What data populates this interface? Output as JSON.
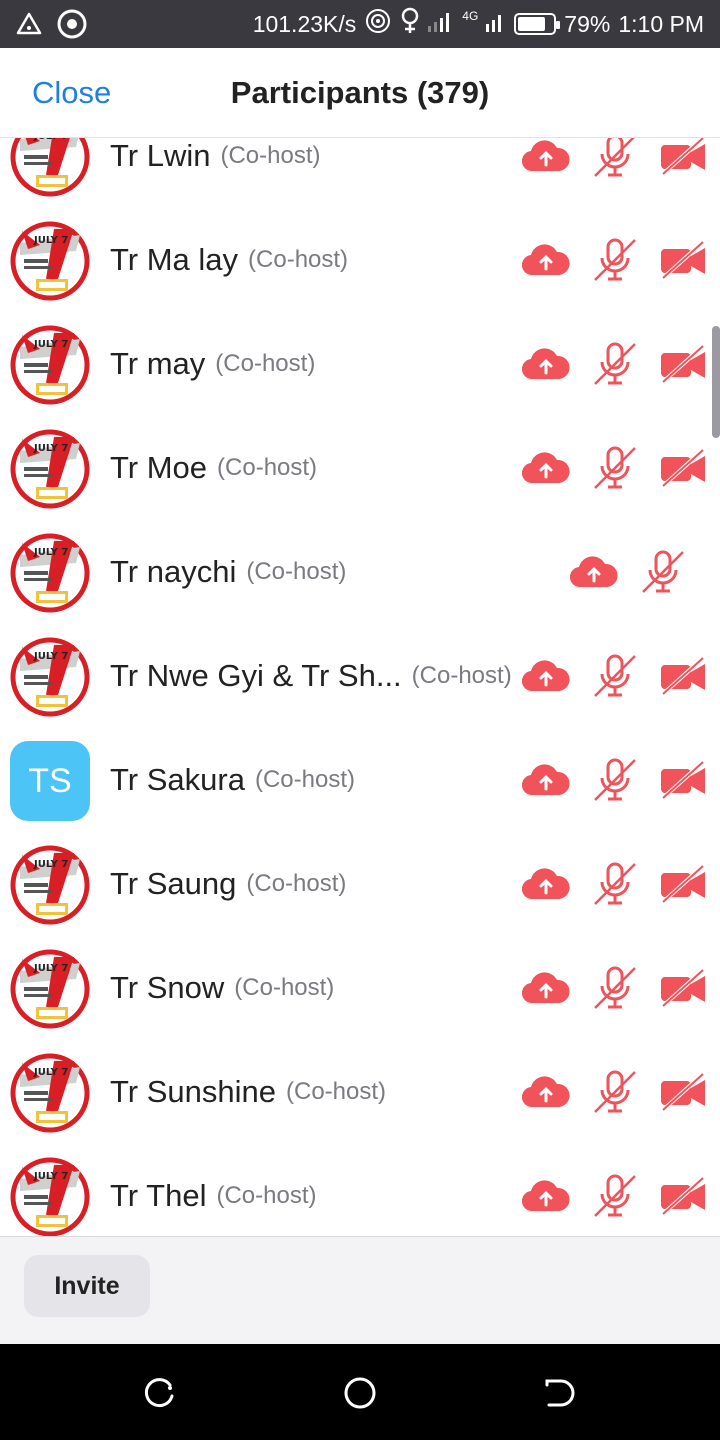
{
  "status_bar": {
    "speed": "101.23K/s",
    "network": "4G",
    "battery": "79%",
    "battery_level": 0.79,
    "time": "1:10 PM",
    "icons": [
      "alert-triangle-icon",
      "target-icon",
      "hotspot-icon",
      "location-pin-icon",
      "signal-icon"
    ]
  },
  "header": {
    "close_label": "Close",
    "title": "Participants (379)"
  },
  "participants": [
    {
      "name": "Tr Lwin",
      "role": "(Co-host)",
      "avatar": "july-logo",
      "video": true
    },
    {
      "name": "Tr Ma lay",
      "role": "(Co-host)",
      "avatar": "july-logo",
      "video": true
    },
    {
      "name": "Tr may",
      "role": "(Co-host)",
      "avatar": "july-logo",
      "video": true
    },
    {
      "name": "Tr Moe",
      "role": "(Co-host)",
      "avatar": "july-logo",
      "video": true
    },
    {
      "name": "Tr naychi",
      "role": "(Co-host)",
      "avatar": "july-logo",
      "video": false
    },
    {
      "name": "Tr Nwe Gyi & Tr Sh...",
      "role": "(Co-host)",
      "avatar": "july-logo",
      "video": true
    },
    {
      "name": "Tr Sakura",
      "role": "(Co-host)",
      "avatar": "initials",
      "initials": "TS",
      "video": true
    },
    {
      "name": "Tr Saung",
      "role": "(Co-host)",
      "avatar": "july-logo",
      "video": true
    },
    {
      "name": "Tr Snow",
      "role": "(Co-host)",
      "avatar": "july-logo",
      "video": true
    },
    {
      "name": "Tr Sunshine",
      "role": "(Co-host)",
      "avatar": "july-logo",
      "video": true
    },
    {
      "name": "Tr Thel",
      "role": "(Co-host)",
      "avatar": "july-logo",
      "video": true
    }
  ],
  "logo_text": "JULY 7",
  "footer": {
    "invite_label": "Invite"
  },
  "colors": {
    "accent": "#1f7fe5",
    "icon_red": "#f0535a",
    "statusbar": "#39393f",
    "initials_bg": "#4cc4f5"
  },
  "nav_icons": [
    "recent-apps-icon",
    "home-icon",
    "back-icon"
  ]
}
